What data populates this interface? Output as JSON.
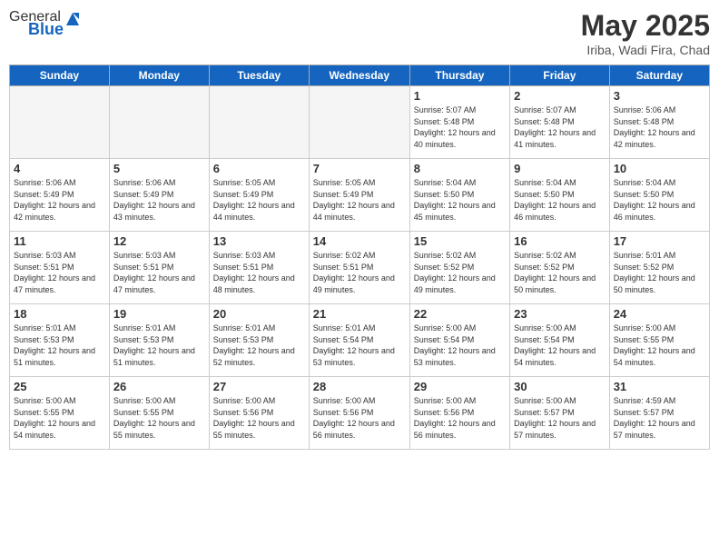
{
  "header": {
    "logo_general": "General",
    "logo_blue": "Blue",
    "month_year": "May 2025",
    "location": "Iriba, Wadi Fira, Chad"
  },
  "days_of_week": [
    "Sunday",
    "Monday",
    "Tuesday",
    "Wednesday",
    "Thursday",
    "Friday",
    "Saturday"
  ],
  "weeks": [
    [
      {
        "day": "",
        "empty": true
      },
      {
        "day": "",
        "empty": true
      },
      {
        "day": "",
        "empty": true
      },
      {
        "day": "",
        "empty": true
      },
      {
        "day": "1",
        "sunrise": "5:07 AM",
        "sunset": "5:48 PM",
        "daylight": "12 hours and 40 minutes."
      },
      {
        "day": "2",
        "sunrise": "5:07 AM",
        "sunset": "5:48 PM",
        "daylight": "12 hours and 41 minutes."
      },
      {
        "day": "3",
        "sunrise": "5:06 AM",
        "sunset": "5:48 PM",
        "daylight": "12 hours and 42 minutes."
      }
    ],
    [
      {
        "day": "4",
        "sunrise": "5:06 AM",
        "sunset": "5:49 PM",
        "daylight": "12 hours and 42 minutes."
      },
      {
        "day": "5",
        "sunrise": "5:06 AM",
        "sunset": "5:49 PM",
        "daylight": "12 hours and 43 minutes."
      },
      {
        "day": "6",
        "sunrise": "5:05 AM",
        "sunset": "5:49 PM",
        "daylight": "12 hours and 44 minutes."
      },
      {
        "day": "7",
        "sunrise": "5:05 AM",
        "sunset": "5:49 PM",
        "daylight": "12 hours and 44 minutes."
      },
      {
        "day": "8",
        "sunrise": "5:04 AM",
        "sunset": "5:50 PM",
        "daylight": "12 hours and 45 minutes."
      },
      {
        "day": "9",
        "sunrise": "5:04 AM",
        "sunset": "5:50 PM",
        "daylight": "12 hours and 46 minutes."
      },
      {
        "day": "10",
        "sunrise": "5:04 AM",
        "sunset": "5:50 PM",
        "daylight": "12 hours and 46 minutes."
      }
    ],
    [
      {
        "day": "11",
        "sunrise": "5:03 AM",
        "sunset": "5:51 PM",
        "daylight": "12 hours and 47 minutes."
      },
      {
        "day": "12",
        "sunrise": "5:03 AM",
        "sunset": "5:51 PM",
        "daylight": "12 hours and 47 minutes."
      },
      {
        "day": "13",
        "sunrise": "5:03 AM",
        "sunset": "5:51 PM",
        "daylight": "12 hours and 48 minutes."
      },
      {
        "day": "14",
        "sunrise": "5:02 AM",
        "sunset": "5:51 PM",
        "daylight": "12 hours and 49 minutes."
      },
      {
        "day": "15",
        "sunrise": "5:02 AM",
        "sunset": "5:52 PM",
        "daylight": "12 hours and 49 minutes."
      },
      {
        "day": "16",
        "sunrise": "5:02 AM",
        "sunset": "5:52 PM",
        "daylight": "12 hours and 50 minutes."
      },
      {
        "day": "17",
        "sunrise": "5:01 AM",
        "sunset": "5:52 PM",
        "daylight": "12 hours and 50 minutes."
      }
    ],
    [
      {
        "day": "18",
        "sunrise": "5:01 AM",
        "sunset": "5:53 PM",
        "daylight": "12 hours and 51 minutes."
      },
      {
        "day": "19",
        "sunrise": "5:01 AM",
        "sunset": "5:53 PM",
        "daylight": "12 hours and 51 minutes."
      },
      {
        "day": "20",
        "sunrise": "5:01 AM",
        "sunset": "5:53 PM",
        "daylight": "12 hours and 52 minutes."
      },
      {
        "day": "21",
        "sunrise": "5:01 AM",
        "sunset": "5:54 PM",
        "daylight": "12 hours and 53 minutes."
      },
      {
        "day": "22",
        "sunrise": "5:00 AM",
        "sunset": "5:54 PM",
        "daylight": "12 hours and 53 minutes."
      },
      {
        "day": "23",
        "sunrise": "5:00 AM",
        "sunset": "5:54 PM",
        "daylight": "12 hours and 54 minutes."
      },
      {
        "day": "24",
        "sunrise": "5:00 AM",
        "sunset": "5:55 PM",
        "daylight": "12 hours and 54 minutes."
      }
    ],
    [
      {
        "day": "25",
        "sunrise": "5:00 AM",
        "sunset": "5:55 PM",
        "daylight": "12 hours and 54 minutes."
      },
      {
        "day": "26",
        "sunrise": "5:00 AM",
        "sunset": "5:55 PM",
        "daylight": "12 hours and 55 minutes."
      },
      {
        "day": "27",
        "sunrise": "5:00 AM",
        "sunset": "5:56 PM",
        "daylight": "12 hours and 55 minutes."
      },
      {
        "day": "28",
        "sunrise": "5:00 AM",
        "sunset": "5:56 PM",
        "daylight": "12 hours and 56 minutes."
      },
      {
        "day": "29",
        "sunrise": "5:00 AM",
        "sunset": "5:56 PM",
        "daylight": "12 hours and 56 minutes."
      },
      {
        "day": "30",
        "sunrise": "5:00 AM",
        "sunset": "5:57 PM",
        "daylight": "12 hours and 57 minutes."
      },
      {
        "day": "31",
        "sunrise": "4:59 AM",
        "sunset": "5:57 PM",
        "daylight": "12 hours and 57 minutes."
      }
    ]
  ]
}
